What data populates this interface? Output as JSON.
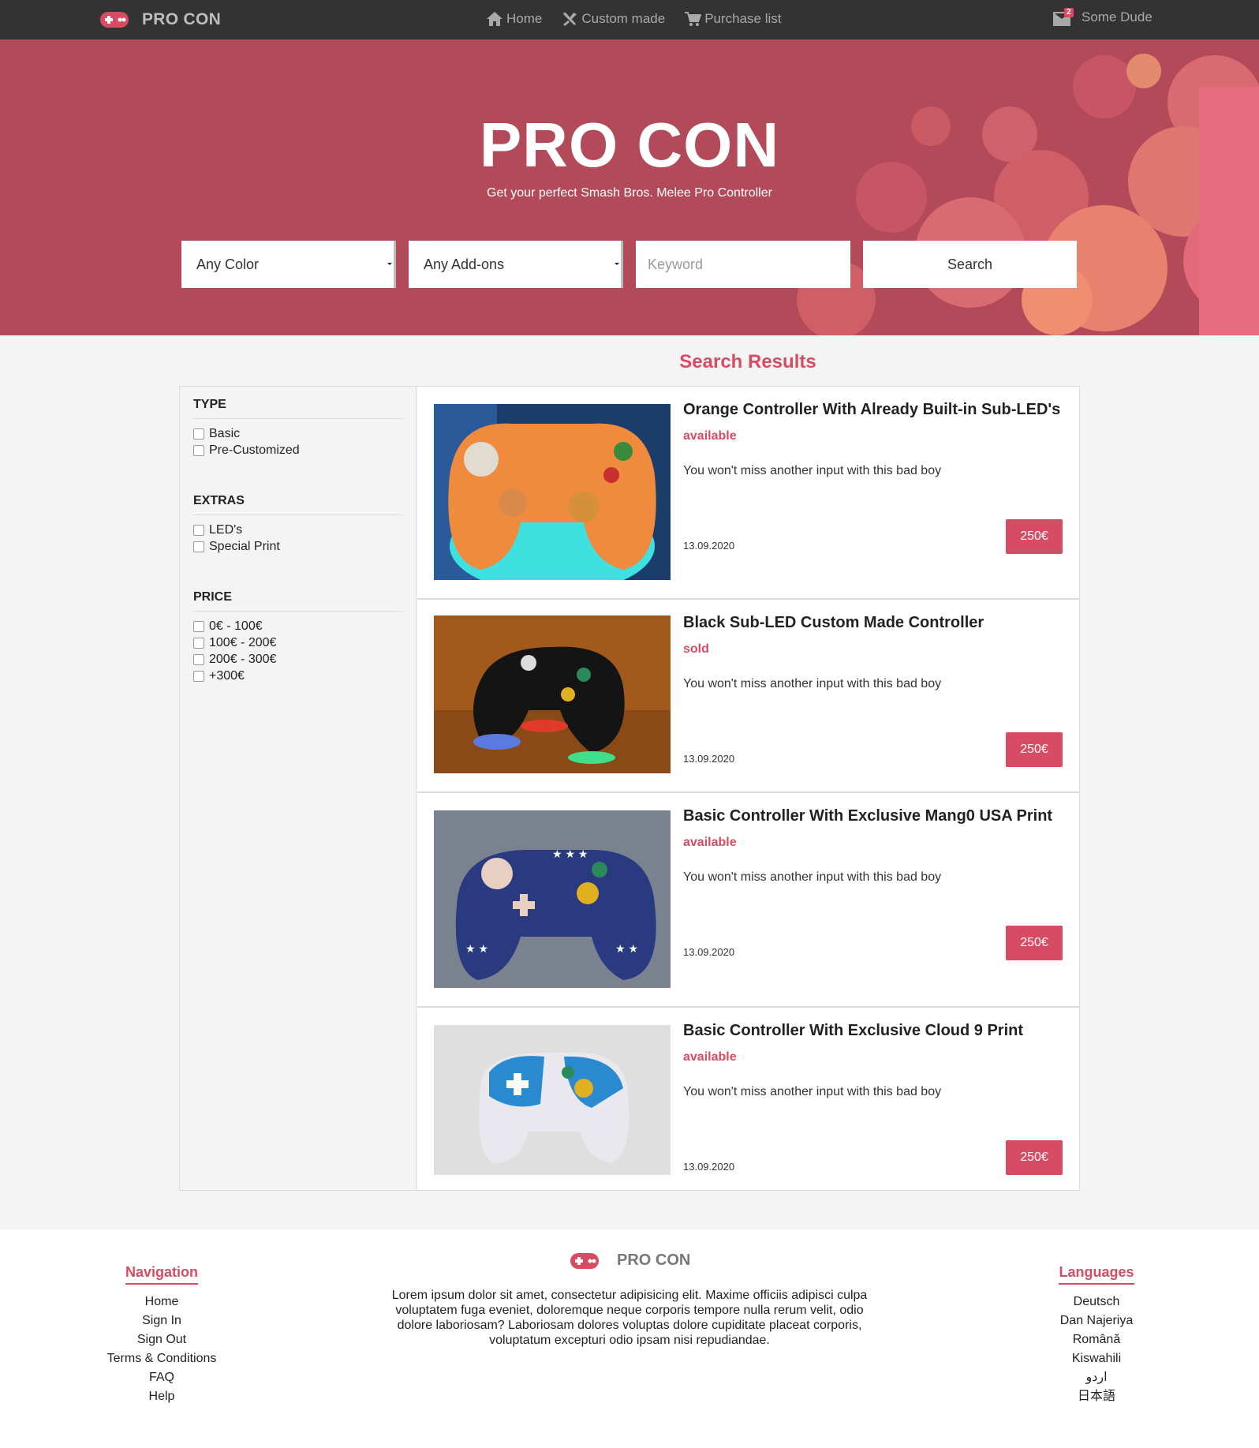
{
  "navbar": {
    "brand": "PRO CON",
    "links": [
      {
        "label": "Home",
        "icon": "home-icon"
      },
      {
        "label": "Custom made",
        "icon": "tools-icon"
      },
      {
        "label": "Purchase list",
        "icon": "cart-icon"
      }
    ],
    "mail_count": "2",
    "user": "Some Dude"
  },
  "hero": {
    "title": "PRO CON",
    "subtitle": "Get your perfect Smash Bros. Melee Pro Controller",
    "color_select": "Any Color",
    "addons_select": "Any Add-ons",
    "keyword_placeholder": "Keyword",
    "search_label": "Search"
  },
  "colors": {
    "accent": "#d74c63",
    "hero_bg": "#b34a59",
    "navbar_bg": "#333333"
  },
  "results": {
    "title": "Search Results",
    "items": [
      {
        "title": "Orange Controller With Already Built-in Sub-LED's",
        "status": "available",
        "description": "You won't miss another input with this bad boy",
        "date": "13.09.2020",
        "price": "250€"
      },
      {
        "title": "Black Sub-LED Custom Made Controller",
        "status": "sold",
        "description": "You won't miss another input with this bad boy",
        "date": "13.09.2020",
        "price": "250€"
      },
      {
        "title": "Basic Controller With Exclusive Mang0 USA Print",
        "status": "available",
        "description": "You won't miss another input with this bad boy",
        "date": "13.09.2020",
        "price": "250€"
      },
      {
        "title": "Basic Controller With Exclusive Cloud 9 Print",
        "status": "available",
        "description": "You won't miss another input with this bad boy",
        "date": "13.09.2020",
        "price": "250€"
      }
    ]
  },
  "filters": {
    "type": {
      "title": "TYPE",
      "options": [
        "Basic",
        "Pre-Customized"
      ]
    },
    "extras": {
      "title": "EXTRAS",
      "options": [
        "LED's",
        "Special Print"
      ]
    },
    "price": {
      "title": "PRICE",
      "options": [
        "0€ - 100€",
        "100€ - 200€",
        "200€ - 300€",
        "+300€"
      ]
    }
  },
  "footer": {
    "nav_title": "Navigation",
    "nav_links": [
      "Home",
      "Sign In",
      "Sign Out",
      "Terms & Conditions",
      "FAQ",
      "Help"
    ],
    "brand": "PRO CON",
    "about": "Lorem ipsum dolor sit amet, consectetur adipisicing elit. Maxime officiis adipisci culpa voluptatem fuga eveniet, doloremque neque corporis tempore nulla rerum velit, odio dolore laboriosam? Laboriosam dolores voluptas dolore cupiditate placeat corporis, voluptatum excepturi odio ipsam nisi repudiandae.",
    "lang_title": "Languages",
    "languages": [
      "Deutsch",
      "Dan Najeriya",
      "Română",
      "Kiswahili",
      "اردو",
      "日本語"
    ]
  }
}
